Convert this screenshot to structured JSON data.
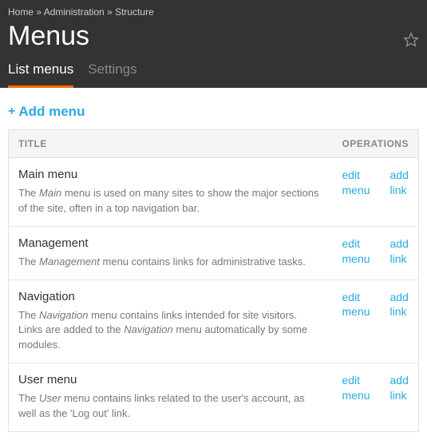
{
  "breadcrumb": {
    "home": "Home",
    "admin": "Administration",
    "structure": "Structure",
    "sep": " » "
  },
  "page_title": "Menus",
  "tabs": {
    "list": "List menus",
    "settings": "Settings"
  },
  "add_menu_label": "Add menu",
  "table": {
    "header_title": "TITLE",
    "header_ops": "OPERATIONS",
    "op_edit": "edit menu",
    "op_add": "add link",
    "rows": [
      {
        "title": "Main menu",
        "desc_pre": "The ",
        "desc_em": "Main",
        "desc_post": " menu is used on many sites to show the major sections of the site, often in a top navigation bar."
      },
      {
        "title": "Management",
        "desc_pre": "The ",
        "desc_em": "Management",
        "desc_post": " menu contains links for administrative tasks."
      },
      {
        "title": "Navigation",
        "desc_pre": "The ",
        "desc_em": "Navigation",
        "desc_post": " menu contains links intended for site visitors. Links are added to the ",
        "desc_em2": "Navigation",
        "desc_post2": " menu automatically by some modules."
      },
      {
        "title": "User menu",
        "desc_pre": "The ",
        "desc_em": "User",
        "desc_post": " menu contains links related to the user's account, as well as the 'Log out' link."
      }
    ]
  }
}
